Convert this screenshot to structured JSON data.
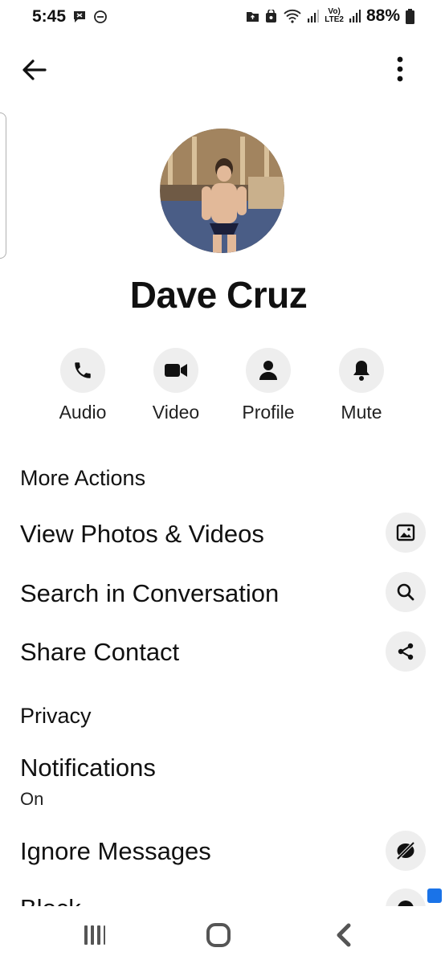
{
  "status_bar": {
    "time": "5:45",
    "battery": "88%",
    "network_label_top": "Vo)",
    "network_label_bottom": "LTE2"
  },
  "contact": {
    "name": "Dave Cruz"
  },
  "quick_actions": [
    {
      "label": "Audio",
      "icon": "phone-icon"
    },
    {
      "label": "Video",
      "icon": "video-camera-icon"
    },
    {
      "label": "Profile",
      "icon": "person-icon"
    },
    {
      "label": "Mute",
      "icon": "bell-icon"
    }
  ],
  "more_actions": {
    "header": "More Actions",
    "items": [
      {
        "label": "View Photos & Videos",
        "icon": "image-icon"
      },
      {
        "label": "Search in Conversation",
        "icon": "search-icon"
      },
      {
        "label": "Share Contact",
        "icon": "share-icon"
      }
    ]
  },
  "privacy": {
    "header": "Privacy",
    "notifications": {
      "label": "Notifications",
      "value": "On"
    },
    "ignore": {
      "label": "Ignore Messages",
      "icon": "eye-off-icon"
    },
    "block": {
      "label": "Block"
    }
  },
  "colors": {
    "icon_bg": "#eeeeee",
    "text": "#111111"
  }
}
